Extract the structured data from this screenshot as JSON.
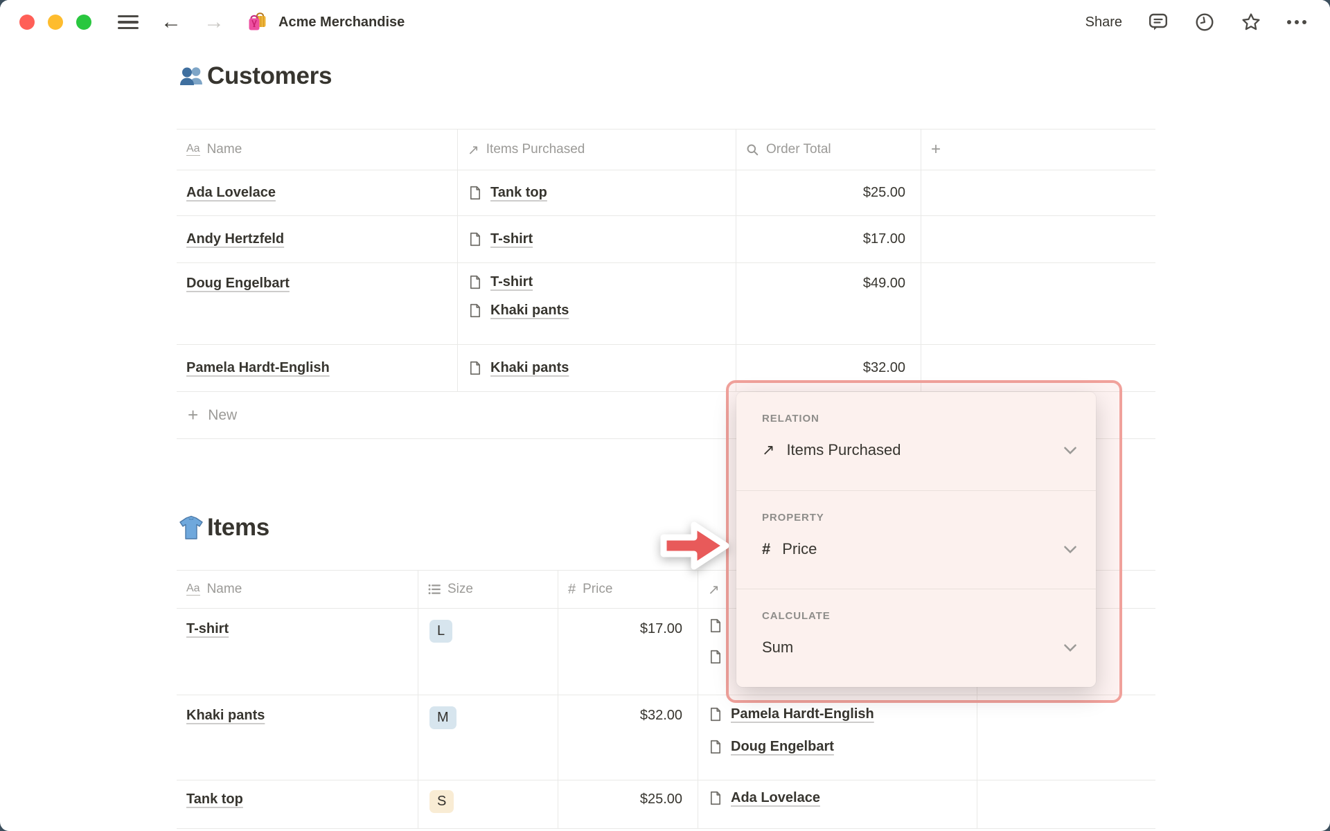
{
  "titlebar": {
    "title": "Acme Merchandise",
    "share_label": "Share"
  },
  "icons": {
    "text_property": "Aa",
    "number_property": "#",
    "arrow_up_right": "↗",
    "plus": "+",
    "back_arrow": "←",
    "forward_arrow": "→"
  },
  "customers": {
    "heading": "Customers",
    "columns": [
      {
        "icon": "text-property",
        "label": "Name"
      },
      {
        "icon": "arrow-up-right",
        "label": "Items Purchased"
      },
      {
        "icon": "magnifier",
        "label": "Order Total"
      },
      {
        "icon": "plus",
        "label": ""
      }
    ],
    "rows": [
      {
        "name": "Ada Lovelace",
        "items": [
          "Tank top"
        ],
        "total": "$25.00"
      },
      {
        "name": "Andy Hertzfeld",
        "items": [
          "T-shirt"
        ],
        "total": "$17.00"
      },
      {
        "name": "Doug Engelbart",
        "items": [
          "T-shirt",
          "Khaki pants"
        ],
        "total": "$49.00"
      },
      {
        "name": "Pamela Hardt-English",
        "items": [
          "Khaki pants"
        ],
        "total": "$32.00"
      }
    ],
    "new_label": "New"
  },
  "items": {
    "heading": "Items",
    "columns": [
      {
        "icon": "text-property",
        "label": "Name"
      },
      {
        "icon": "select-list",
        "label": "Size"
      },
      {
        "icon": "number-property",
        "label": "Price"
      },
      {
        "icon": "arrow-up-right",
        "label": ""
      }
    ],
    "rows": [
      {
        "name": "T-shirt",
        "size": "L",
        "size_color": "blue",
        "price": "$17.00",
        "customers": []
      },
      {
        "name": "Khaki pants",
        "size": "M",
        "size_color": "blue",
        "price": "$32.00",
        "customers": [
          "Pamela Hardt-English",
          "Doug Engelbart"
        ]
      },
      {
        "name": "Tank top",
        "size": "S",
        "size_color": "yellow",
        "price": "$25.00",
        "customers": [
          "Ada Lovelace"
        ]
      }
    ]
  },
  "popup": {
    "sections": [
      {
        "label": "RELATION",
        "value": "Items Purchased",
        "icon": "arrow-up-right"
      },
      {
        "label": "PROPERTY",
        "value": "Price",
        "icon": "number-property"
      },
      {
        "label": "CALCULATE",
        "value": "Sum",
        "icon": null
      }
    ]
  },
  "colors": {
    "text_primary": "#37352F",
    "text_gray": "#9B9A97",
    "row_border": "#E9E9E7",
    "accent_red_arrow": "#E85A5A",
    "highlight_border": "#F0A19B",
    "popup_bg": "#FCF1EE",
    "badge_blue_bg": "#D7E5EE",
    "badge_yellow_bg": "#F9ECD4",
    "traffic_red": "#FF5F57",
    "traffic_yellow": "#FEBC2E",
    "traffic_green": "#29C73F"
  }
}
